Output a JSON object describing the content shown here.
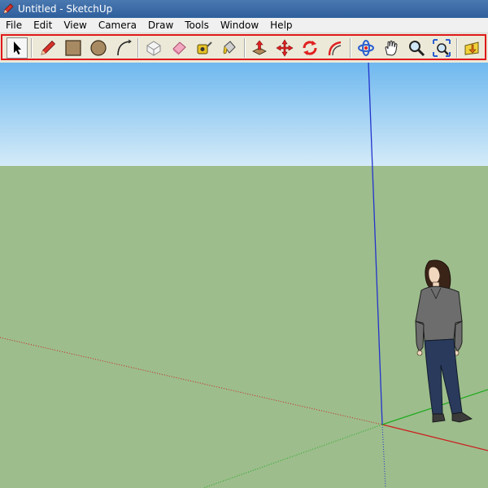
{
  "window": {
    "title": "Untitled - SketchUp",
    "app_icon": "sketchup-pencil-icon"
  },
  "menubar": {
    "items": [
      {
        "label": "File"
      },
      {
        "label": "Edit"
      },
      {
        "label": "View"
      },
      {
        "label": "Camera"
      },
      {
        "label": "Draw"
      },
      {
        "label": "Tools"
      },
      {
        "label": "Window"
      },
      {
        "label": "Help"
      }
    ]
  },
  "toolbar": {
    "highlight_color": "#e0191c",
    "selected_tool": "select",
    "tools": [
      {
        "name": "select-tool",
        "icon": "arrow-cursor-icon"
      },
      {
        "name": "line-tool",
        "icon": "pencil-icon"
      },
      {
        "name": "rectangle-tool",
        "icon": "rectangle-icon"
      },
      {
        "name": "circle-tool",
        "icon": "circle-icon"
      },
      {
        "name": "arc-tool",
        "icon": "arc-icon"
      },
      {
        "name": "make-component-tool",
        "icon": "component-box-icon"
      },
      {
        "name": "eraser-tool",
        "icon": "eraser-icon"
      },
      {
        "name": "tape-measure-tool",
        "icon": "tape-measure-icon"
      },
      {
        "name": "paint-bucket-tool",
        "icon": "paint-bucket-icon"
      },
      {
        "name": "push-pull-tool",
        "icon": "push-pull-icon"
      },
      {
        "name": "move-tool",
        "icon": "move-arrows-icon"
      },
      {
        "name": "rotate-tool",
        "icon": "rotate-icon"
      },
      {
        "name": "offset-tool",
        "icon": "offset-icon"
      },
      {
        "name": "orbit-tool",
        "icon": "orbit-icon"
      },
      {
        "name": "pan-tool",
        "icon": "hand-icon"
      },
      {
        "name": "zoom-tool",
        "icon": "magnifier-icon"
      },
      {
        "name": "zoom-extents-tool",
        "icon": "zoom-extents-icon"
      },
      {
        "name": "get-models-tool",
        "icon": "warehouse-icon"
      }
    ]
  },
  "viewport": {
    "sky_top_color": "#6fb8ef",
    "sky_bottom_color": "#d4ebf8",
    "ground_color": "#9dbd8c",
    "axis_colors": {
      "red": "#cc2222",
      "green": "#22aa22",
      "blue": "#2233cc"
    },
    "figure": "person-scale-figure"
  }
}
